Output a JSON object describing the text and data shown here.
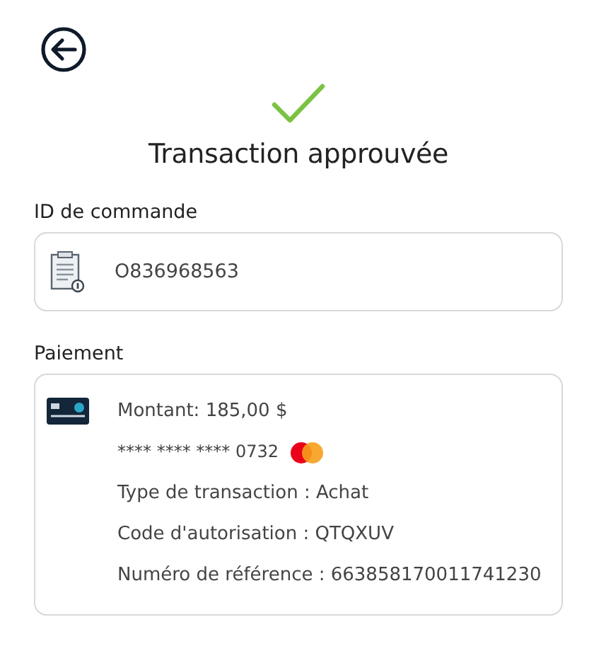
{
  "title": "Transaction approuvée",
  "order": {
    "label": "ID de commande",
    "value": "O836968563"
  },
  "payment": {
    "label": "Paiement",
    "amount": "Montant: 185,00 $",
    "card_number": "**** **** **** 0732",
    "details": [
      "Type de transaction : Achat",
      "Code d'autorisation : QTQXUV",
      "Numéro de référence : 663858170011741230"
    ]
  }
}
